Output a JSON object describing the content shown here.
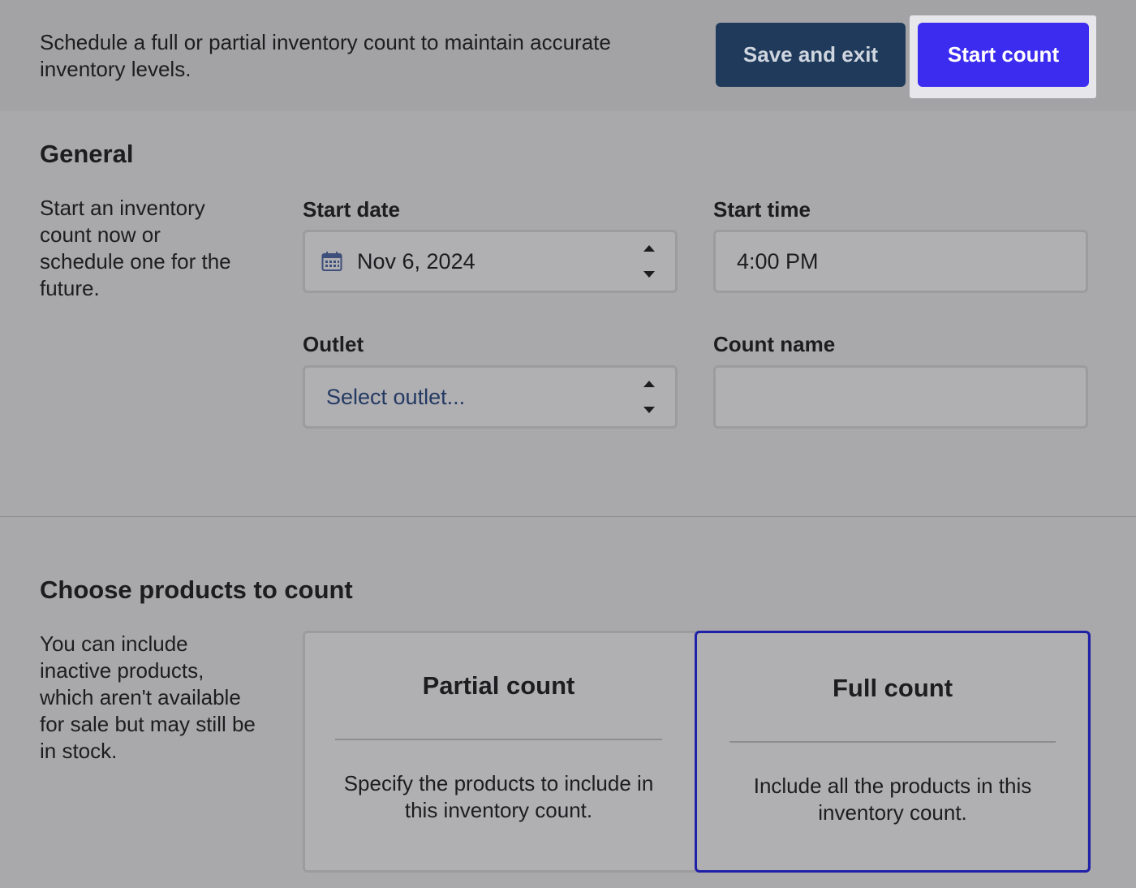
{
  "header": {
    "intro": "Schedule a full or partial inventory count to maintain accurate inventory levels.",
    "save_label": "Save and exit",
    "start_label": "Start count"
  },
  "general": {
    "title": "General",
    "description": "Start an inventory count now or schedule one for the future.",
    "start_date": {
      "label": "Start date",
      "value": "Nov 6, 2024",
      "icon": "calendar-icon"
    },
    "start_time": {
      "label": "Start time",
      "value": "4:00 PM"
    },
    "outlet": {
      "label": "Outlet",
      "placeholder": "Select outlet..."
    },
    "count_name": {
      "label": "Count name",
      "value": ""
    }
  },
  "products": {
    "title": "Choose products to count",
    "description": "You can include inactive products, which aren't available for sale but may still be in stock.",
    "options": [
      {
        "title": "Partial count",
        "description": "Specify the products to include in this inventory count.",
        "selected": false
      },
      {
        "title": "Full count",
        "description": "Include all the products in this inventory count.",
        "selected": true
      }
    ]
  },
  "colors": {
    "primary_button": "#3b2cf0",
    "secondary_button": "#1f3a5b",
    "selected_border": "#1f1fa8"
  }
}
